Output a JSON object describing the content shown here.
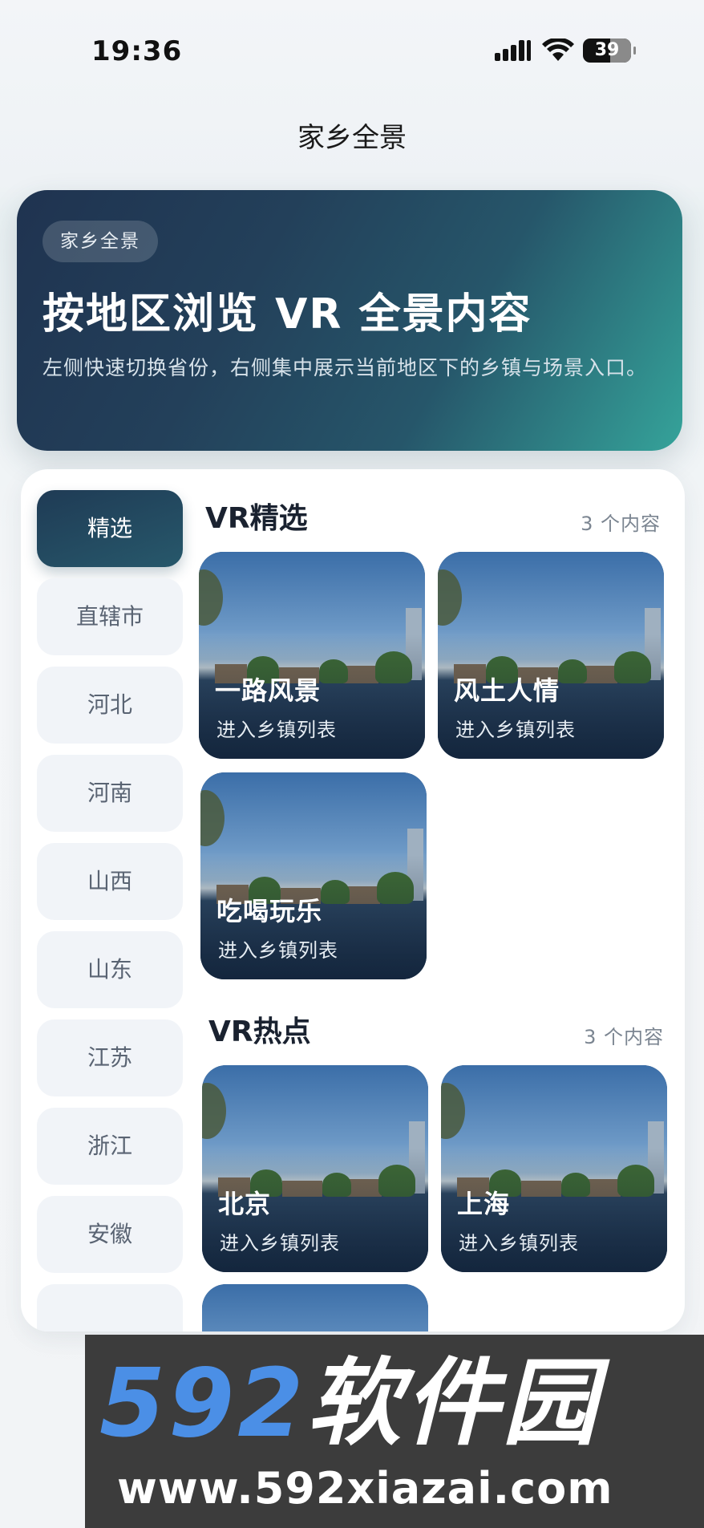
{
  "status_bar": {
    "time": "19:36",
    "battery": "39"
  },
  "nav": {
    "title": "家乡全景"
  },
  "hero": {
    "badge": "家乡全景",
    "title": "按地区浏览 VR 全景内容",
    "description": "左侧快速切换省份，右侧集中展示当前地区下的乡镇与场景入口。"
  },
  "sidebar": {
    "items": [
      {
        "label": "精选",
        "active": true
      },
      {
        "label": "直辖市"
      },
      {
        "label": "河北"
      },
      {
        "label": "河南"
      },
      {
        "label": "山西"
      },
      {
        "label": "山东"
      },
      {
        "label": "江苏"
      },
      {
        "label": "浙江"
      },
      {
        "label": "安徽"
      }
    ]
  },
  "sections": [
    {
      "title": "VR精选",
      "count": "3 个内容",
      "cards": [
        {
          "title": "一路风景",
          "subtitle": "进入乡镇列表"
        },
        {
          "title": "风土人情",
          "subtitle": "进入乡镇列表"
        },
        {
          "title": "吃喝玩乐",
          "subtitle": "进入乡镇列表"
        }
      ]
    },
    {
      "title": "VR热点",
      "count": "3 个内容",
      "cards": [
        {
          "title": "北京",
          "subtitle": "进入乡镇列表"
        },
        {
          "title": "上海",
          "subtitle": "进入乡镇列表"
        }
      ]
    }
  ],
  "watermark": {
    "logo_num": "592",
    "logo_text": "软件园",
    "url": "www.592xiazai.com"
  }
}
